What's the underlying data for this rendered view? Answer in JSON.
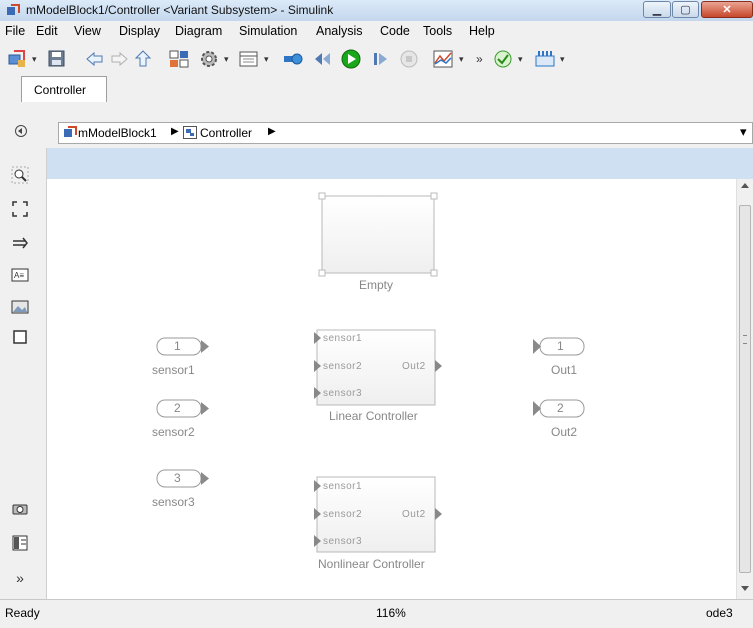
{
  "window": {
    "title": "mModelBlock1/Controller  <Variant Subsystem> - Simulink",
    "min_glyph": "▁",
    "max_glyph": "▢",
    "close_glyph": "✕"
  },
  "menu": [
    "File",
    "Edit",
    "View",
    "Display",
    "Diagram",
    "Simulation",
    "Analysis",
    "Code",
    "Tools",
    "Help"
  ],
  "toolbar": {
    "dropdown_glyph": "▾",
    "overflow": "»"
  },
  "tabs": [
    {
      "label": "Controller"
    }
  ],
  "breadcrumb": {
    "root": "mModelBlock1",
    "separator": "▶",
    "child": "Controller",
    "end": "▶",
    "dropdown": "▾"
  },
  "palette": {
    "more": "»"
  },
  "diagram": {
    "empty_label": "Empty",
    "inports": [
      {
        "num": "1",
        "label": "sensor1"
      },
      {
        "num": "2",
        "label": "sensor2"
      },
      {
        "num": "3",
        "label": "sensor3"
      }
    ],
    "outports": [
      {
        "num": "1",
        "label": "Out1"
      },
      {
        "num": "2",
        "label": "Out2"
      }
    ],
    "linear": {
      "label": "Linear Controller",
      "in1": "sensor1",
      "in2": "sensor2",
      "in3": "sensor3",
      "out": "Out2"
    },
    "nonlinear": {
      "label": "Nonlinear Controller",
      "in1": "sensor1",
      "in2": "sensor2",
      "in3": "sensor3",
      "out": "Out2"
    }
  },
  "status": {
    "left": "Ready",
    "zoom": "116%",
    "solver": "ode3"
  },
  "colors": {
    "run_green": "#1aa71a",
    "accent_blue": "#2e75c5",
    "close_red": "#c7472c"
  }
}
